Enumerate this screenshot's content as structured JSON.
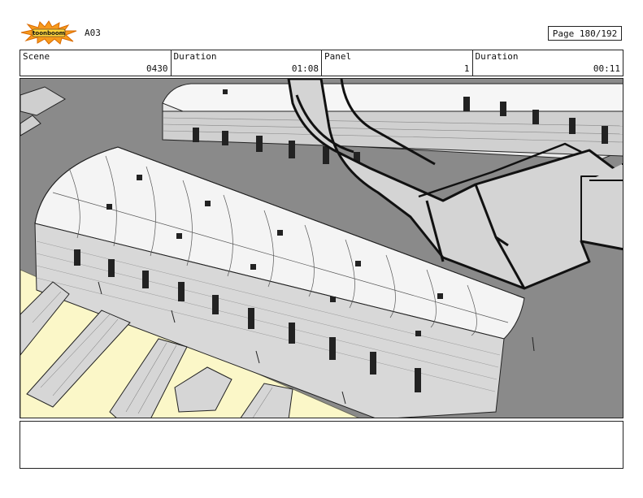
{
  "header": {
    "logo_icon": "toonboom-logo-icon",
    "sequence": "A03",
    "page": "Page 180/192"
  },
  "info": {
    "scene_label": "Scene",
    "scene_value": "0430",
    "duration_label": "Duration",
    "duration_value": "01:08",
    "panel_label": "Panel",
    "panel_value": "1",
    "panel_duration_label": "Duration",
    "panel_duration_value": "00:11"
  },
  "notes": {
    "text": ""
  },
  "colors": {
    "ground": "#8a8a8a",
    "grass": "#fbf7c8",
    "roof": "#f4f4f4",
    "line": "#111111"
  }
}
